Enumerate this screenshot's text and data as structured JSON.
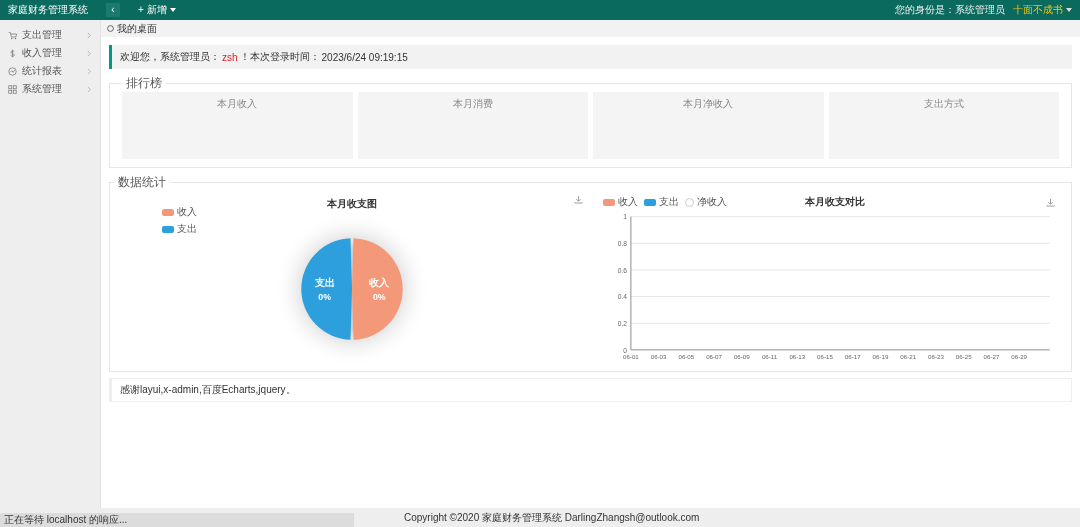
{
  "header": {
    "title": "家庭财务管理系统",
    "collapse_icon": "‹",
    "add_menu": "+ 新增",
    "identity": "您的身份是：系统管理员",
    "user": "十面不成书"
  },
  "sidebar": {
    "items": [
      {
        "label": "支出管理",
        "expanded": false
      },
      {
        "label": "收入管理",
        "expanded": false
      },
      {
        "label": "统计报表",
        "expanded": false
      },
      {
        "label": "系统管理",
        "expanded": false
      }
    ]
  },
  "tabs": [
    {
      "label": "我的桌面",
      "selected": true
    }
  ],
  "welcome": {
    "prefix": "欢迎您，系统管理员：",
    "user": "zsh",
    "suffix": "！本次登录时间：",
    "time": "2023/6/24 09:19:15"
  },
  "ranking": {
    "title": "排行榜",
    "cards": [
      "本月收入",
      "本月消费",
      "本月净收入",
      "支出方式"
    ]
  },
  "stats": {
    "title": "数据统计",
    "pie": {
      "title": "本月收支图",
      "legend": [
        {
          "label": "收入",
          "color": "#f4987a"
        },
        {
          "label": "支出",
          "color": "#2d9fdc"
        }
      ],
      "slices": [
        {
          "label": "支出",
          "value": "0%",
          "color": "#2d9fdc"
        },
        {
          "label": "收入",
          "value": "0%",
          "color": "#f4987a"
        }
      ]
    },
    "line": {
      "legend": [
        {
          "kind": "rect"
        },
        {
          "kind": "rect"
        },
        {
          "kind": "circle"
        }
      ],
      "chart_data": {
        "type": "line",
        "title": "本月收支对比",
        "grid": true,
        "categories": [
          "06-01",
          "06-03",
          "06-05",
          "06-07",
          "06-09",
          "06-11",
          "06-13",
          "06-15",
          "06-17",
          "06-19",
          "06-21",
          "06-23",
          "06-25",
          "06-27",
          "06-29"
        ],
        "ylim": [
          0,
          1
        ],
        "yticks": [
          0,
          0.2,
          0.4,
          0.6,
          0.8,
          1
        ],
        "series": [
          {
            "name": "收入",
            "color": "#f4987a",
            "values": [
              null,
              null,
              null,
              null,
              null,
              null,
              null,
              null,
              null,
              null,
              null,
              null,
              null,
              null,
              null
            ]
          },
          {
            "name": "支出",
            "color": "#2d9fdc",
            "values": [
              null,
              null,
              null,
              null,
              null,
              null,
              null,
              null,
              null,
              null,
              null,
              null,
              null,
              null,
              null
            ]
          },
          {
            "name": "净收入",
            "color": "#cccccc",
            "values": [
              null,
              null,
              null,
              null,
              null,
              null,
              null,
              null,
              null,
              null,
              null,
              null,
              null,
              null,
              null
            ]
          }
        ]
      }
    }
  },
  "thanks": "感谢layui,x-admin,百度Echarts,jquery。",
  "footer": "Copyright ©2020 家庭财务管理系统 DarlingZhangsh@outlook.com",
  "status_bar": "正在等待 localhost 的响应..."
}
